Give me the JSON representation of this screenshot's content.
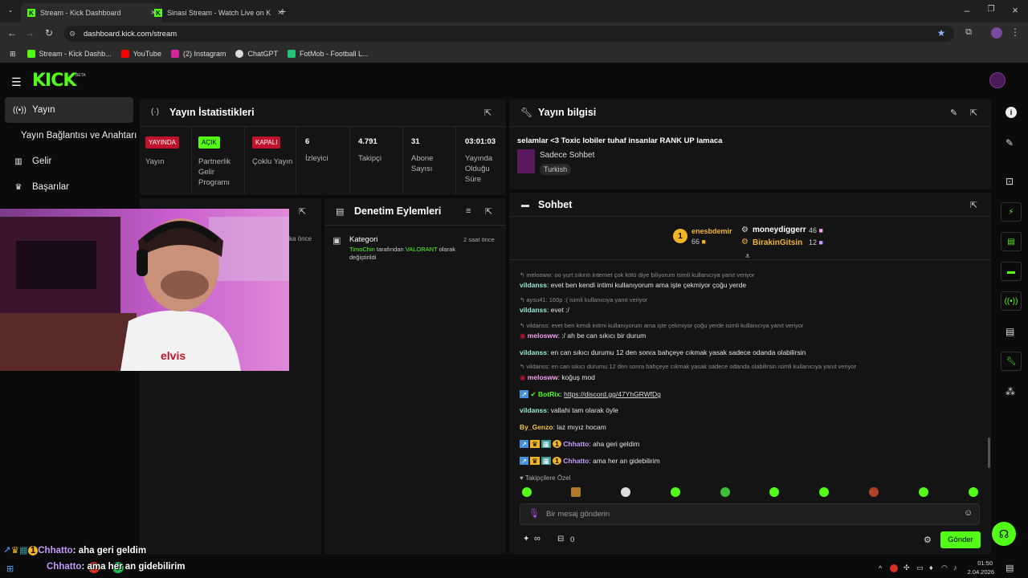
{
  "browser": {
    "tabs": [
      {
        "label": "Stream - Kick Dashboard"
      },
      {
        "label": "Sinasi Stream - Watch Live on K"
      }
    ],
    "address": "dashboard.kick.com/stream",
    "bookmarks": [
      "Stream - Kick Dashb...",
      "YouTube",
      "(2) Instagram",
      "ChatGPT",
      "FotMob - Football L..."
    ]
  },
  "app": {
    "logo": "KICK",
    "logo_badge": "BETA"
  },
  "sidebar": {
    "items": [
      {
        "label": "Yayın"
      },
      {
        "label": "Yayın Bağlantısı ve Anahtarı"
      },
      {
        "label": "Gelir"
      },
      {
        "label": "Başarılar"
      }
    ]
  },
  "stats": {
    "title": "Yayın İstatistikleri",
    "cols": [
      {
        "badge": "YAYINDA",
        "label": "Yayın",
        "badge_color": "#c0132b"
      },
      {
        "badge": "AÇIK",
        "label": "Partnerlik Gelir Programı",
        "badge_color": "#53fc18"
      },
      {
        "badge": "KAPALI",
        "label": "Çoklu Yayın",
        "badge_color": "#c0132b"
      },
      {
        "value": "6",
        "label": "İzleyici"
      },
      {
        "value": "4.791",
        "label": "Takipçi"
      },
      {
        "value": "31",
        "label": "Abone Sayısı"
      },
      {
        "value": "03:01:03",
        "label": "Yayında Olduğu Süre"
      }
    ]
  },
  "info": {
    "title": "Yayın bilgisi",
    "stream_title": "selamlar <3 Toxic lobiler tuhaf insanlar RANK UP lamaca",
    "category": "Sadece Sohbet",
    "tag": "Turkish"
  },
  "partial_panel": {
    "time": "ka önce"
  },
  "moderation": {
    "title": "Denetim Eylemleri",
    "entry_title": "Kategori",
    "entry_time": "2 saat önce",
    "entry_user": "TimoChin",
    "entry_text1": " tarafından ",
    "entry_cat": "VALORANT",
    "entry_text2": " olarak",
    "entry_text3": "değiştirildi"
  },
  "chat": {
    "title": "Sohbet",
    "leaders": {
      "first_name": "enesbdemir",
      "first_count": "66",
      "rank": "1",
      "second_name": "moneydiggerr",
      "second_count": "46",
      "third_name": "BirakinGitsin",
      "third_count": "12"
    },
    "messages": [
      {
        "reply": "melosww: oo yurt sıkıntı internet çok kötü diye biliyorum isimli kullanıcıya yanıt veriyor",
        "user": "vildanss",
        "text": ": evet ben kendi intimi kullanıyorum ama işte çekmiyor çoğu yerde",
        "color": "#9be8d8"
      },
      {
        "reply": "aysu41: 160p :( isimli kullanıcıya yanıt veriyor",
        "user": "vildanss",
        "text": ": evet :/",
        "color": "#9be8d8"
      },
      {
        "reply": "vildanss: evet ben kendi intimi kullanıyorum ama işte çekmiyor çoğu yerde isimli kullanıcıya yanıt veriyor",
        "user": "melosww",
        "text": ": :/ ah be can sıkıcı bir durum",
        "color": "#f5a2f0"
      },
      {
        "user": "vildanss",
        "text": ": en can sıkıcı durumu 12 den sonra bahçeye cıkmak yasak sadece odanda olabilirsin",
        "color": "#9be8d8"
      },
      {
        "reply": "vildanss: en can sıkıcı durumu 12 den sonra bahçeye cıkmak yasak sadece odanda olabilirsin isimli kullanıcıya yanıt veriyor",
        "user": "melosww",
        "text": ": koğuş mod",
        "color": "#f5a2f0"
      },
      {
        "user": "BotRix",
        "text": ": ",
        "link": "https://discord.gg/47YhGRWfDg",
        "color": "#53fc18"
      },
      {
        "user": "vildanss",
        "text": ": vallahi tam olarak öyle",
        "color": "#9be8d8"
      },
      {
        "user": "By_Genzo",
        "text": ": laz mıyız hocam",
        "color": "#f0c24a"
      },
      {
        "user": "Chhatto",
        "text": ": aha geri geldim",
        "color": "#c99bff",
        "rank": "1"
      },
      {
        "user": "Chhatto",
        "text": ": ama her an gidebilirim",
        "color": "#c99bff",
        "rank": "1"
      }
    ],
    "emote_section": "Takipçilere Özel",
    "input_placeholder": "Bir mesaj gönderin",
    "infinity": "∞",
    "gift_count": "0",
    "send_label": "Gönder"
  },
  "overlay": {
    "line1_user": "Chhatto",
    "line1_text": ": aha geri geldim",
    "line2_user": "Chhatto",
    "line2_text": ": ama her an gidebilirim",
    "rank": "1"
  },
  "taskbar": {
    "time": "01:50",
    "date": "2.04.2026"
  },
  "colors": {
    "accent": "#53fc18",
    "live_red": "#c0132b",
    "panel": "#141414"
  }
}
